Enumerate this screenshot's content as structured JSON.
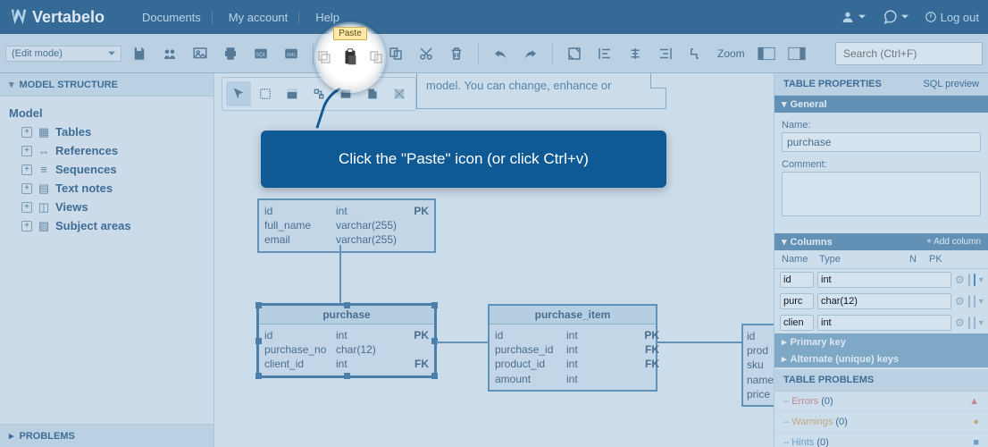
{
  "brand": "Vertabelo",
  "nav": {
    "documents": "Documents",
    "account": "My account",
    "help": "Help",
    "logout": "Log out"
  },
  "toolbar": {
    "mode": "(Edit mode)",
    "zoom": "Zoom",
    "search_placeholder": "Search (Ctrl+F)",
    "paste_tooltip": "Paste"
  },
  "callout_text": "Click the \"Paste\" icon (or click Ctrl+v)",
  "sidebar": {
    "title": "MODEL STRUCTURE",
    "root": "Model",
    "items": [
      "Tables",
      "References",
      "Sequences",
      "Text notes",
      "Views",
      "Subject areas"
    ],
    "problems": "PROBLEMS"
  },
  "note_text": "model. You can change, enhance or",
  "entities": {
    "client": {
      "cols": [
        {
          "n": "id",
          "t": "int",
          "k": "PK"
        },
        {
          "n": "full_name",
          "t": "varchar(255)",
          "k": ""
        },
        {
          "n": "email",
          "t": "varchar(255)",
          "k": ""
        }
      ]
    },
    "purchase": {
      "name": "purchase",
      "cols": [
        {
          "n": "id",
          "t": "int",
          "k": "PK"
        },
        {
          "n": "purchase_no",
          "t": "char(12)",
          "k": ""
        },
        {
          "n": "client_id",
          "t": "int",
          "k": "FK"
        }
      ]
    },
    "purchase_item": {
      "name": "purchase_item",
      "cols": [
        {
          "n": "id",
          "t": "int",
          "k": "PK"
        },
        {
          "n": "purchase_id",
          "t": "int",
          "k": "FK"
        },
        {
          "n": "product_id",
          "t": "int",
          "k": "FK"
        },
        {
          "n": "amount",
          "t": "int",
          "k": ""
        }
      ]
    },
    "product_stub": {
      "cols": [
        "id",
        "prod",
        "sku",
        "name",
        "price"
      ]
    }
  },
  "props": {
    "title": "TABLE PROPERTIES",
    "sql": "SQL preview",
    "sections": {
      "general": "General",
      "columns": "Columns",
      "add": "+ Add column",
      "pk": "Primary key",
      "ak": "Alternate (unique) keys"
    },
    "name_label": "Name:",
    "name_value": "purchase",
    "comment_label": "Comment:",
    "col_hdr": {
      "name": "Name",
      "type": "Type",
      "n": "N",
      "pk": "PK"
    },
    "cols": [
      {
        "n": "id",
        "t": "int",
        "null": false,
        "pk": true
      },
      {
        "n": "purc",
        "t": "char(12)",
        "null": false,
        "pk": false
      },
      {
        "n": "clien",
        "t": "int",
        "null": false,
        "pk": false
      }
    ],
    "problems": {
      "title": "TABLE PROBLEMS",
      "errors": "Errors",
      "ecount": "(0)",
      "warnings": "Warnings",
      "wcount": "(0)",
      "hints": "Hints",
      "hcount": "(0)"
    }
  }
}
